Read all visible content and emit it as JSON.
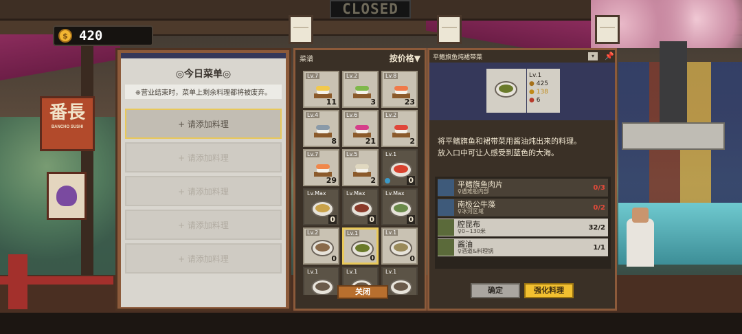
{
  "hud": {
    "status_sign": "CLOSED",
    "coins": "420"
  },
  "scene": {
    "shop_sign": "番長",
    "shop_sign_sub": "BANCHO SUSHI"
  },
  "today_menu": {
    "title": "◎今日菜单◎",
    "note": "※营业结束时，菜单上剩余料理都将被废弃。",
    "slots": [
      "+ 请添加料理",
      "+ 请添加料理",
      "+ 请添加料理",
      "+ 请添加料理",
      "+ 请添加料理"
    ]
  },
  "dish_list": {
    "title": "菜谱",
    "sort_label": "按价格▼",
    "close_label": "关闭",
    "items": [
      {
        "level": "Lv.7",
        "count": "11",
        "icon": "sushi-tamago-icon",
        "topping": "#f2c94c"
      },
      {
        "level": "Lv.2",
        "count": "3",
        "icon": "sushi-green-icon",
        "topping": "#7fb84a"
      },
      {
        "level": "Lv.8",
        "count": "23",
        "icon": "sushi-salmon-icon",
        "topping": "#f07a4a"
      },
      {
        "level": "Lv.4",
        "count": "8",
        "icon": "sushi-mackerel-icon",
        "topping": "#8a9aa8"
      },
      {
        "level": "Lv.6",
        "count": "21",
        "icon": "sushi-tuna-icon",
        "topping": "#d63e8a"
      },
      {
        "level": "Lv.2",
        "count": "2",
        "icon": "sushi-roll-icon",
        "topping": "#e0463a"
      },
      {
        "level": "Lv.7",
        "count": "29",
        "icon": "sushi-shrimp-icon",
        "topping": "#f0874a"
      },
      {
        "level": "Lv.5",
        "count": "2",
        "icon": "sushi-fish-icon",
        "topping": "#e0d8c0"
      },
      {
        "level": "Lv.1",
        "count": "0",
        "icon": "bowl-donburi-icon",
        "food": "#d8422e",
        "dark": true,
        "lock": true
      },
      {
        "level": "Lv.Max",
        "count": "0",
        "icon": "bowl-fried-rice-icon",
        "food": "#c9a24a",
        "dark": true
      },
      {
        "level": "Lv.Max",
        "count": "0",
        "icon": "bowl-curry-icon",
        "food": "#8a3a2a",
        "dark": true
      },
      {
        "level": "Lv.Max",
        "count": "0",
        "icon": "bowl-soup-icon",
        "food": "#6a8a4a",
        "dark": true
      },
      {
        "level": "Lv.2",
        "count": "0",
        "icon": "bowl-noodle-icon",
        "food": "#8a6a4a"
      },
      {
        "level": "Lv.1",
        "count": "0",
        "icon": "bowl-stew-icon",
        "food": "#6a7a2a",
        "selected": true
      },
      {
        "level": "Lv.1",
        "count": "0",
        "icon": "bowl-fish-stew-icon",
        "food": "#9a8a5a"
      },
      {
        "level": "Lv.1",
        "count": "",
        "icon": "bowl-icon",
        "food": "#6a5a4a",
        "dark": true
      },
      {
        "level": "Lv.1",
        "count": "",
        "icon": "bowl-icon",
        "food": "#6a5a4a",
        "dark": true
      },
      {
        "level": "Lv.1",
        "count": "",
        "icon": "bowl-icon",
        "food": "#6a5a4a",
        "dark": true
      }
    ]
  },
  "detail": {
    "title": "平鳍旗鱼炖裙带菜",
    "level": "Lv.1",
    "price": "425",
    "taste": "138",
    "quantity": "6",
    "description_line1": "将平鳍旗鱼和裙带菜用酱油炖出来的料理。",
    "description_line2": "放入口中可让人感受到蓝色的大海。",
    "ingredients": [
      {
        "name": "平鳍旗鱼肉片",
        "source": "♀遇难船内部",
        "qty": "0/3",
        "ok": false
      },
      {
        "name": "南极公牛藻",
        "source": "♀冰河区域",
        "qty": "0/2",
        "ok": false
      },
      {
        "name": "腔昆布",
        "source": "♀0~130米",
        "qty": "32/2",
        "ok": true
      },
      {
        "name": "酱油",
        "source": "♀酒道&料理锅",
        "qty": "1/1",
        "ok": true
      }
    ],
    "confirm_label": "确定",
    "enhance_label": "强化料理"
  }
}
